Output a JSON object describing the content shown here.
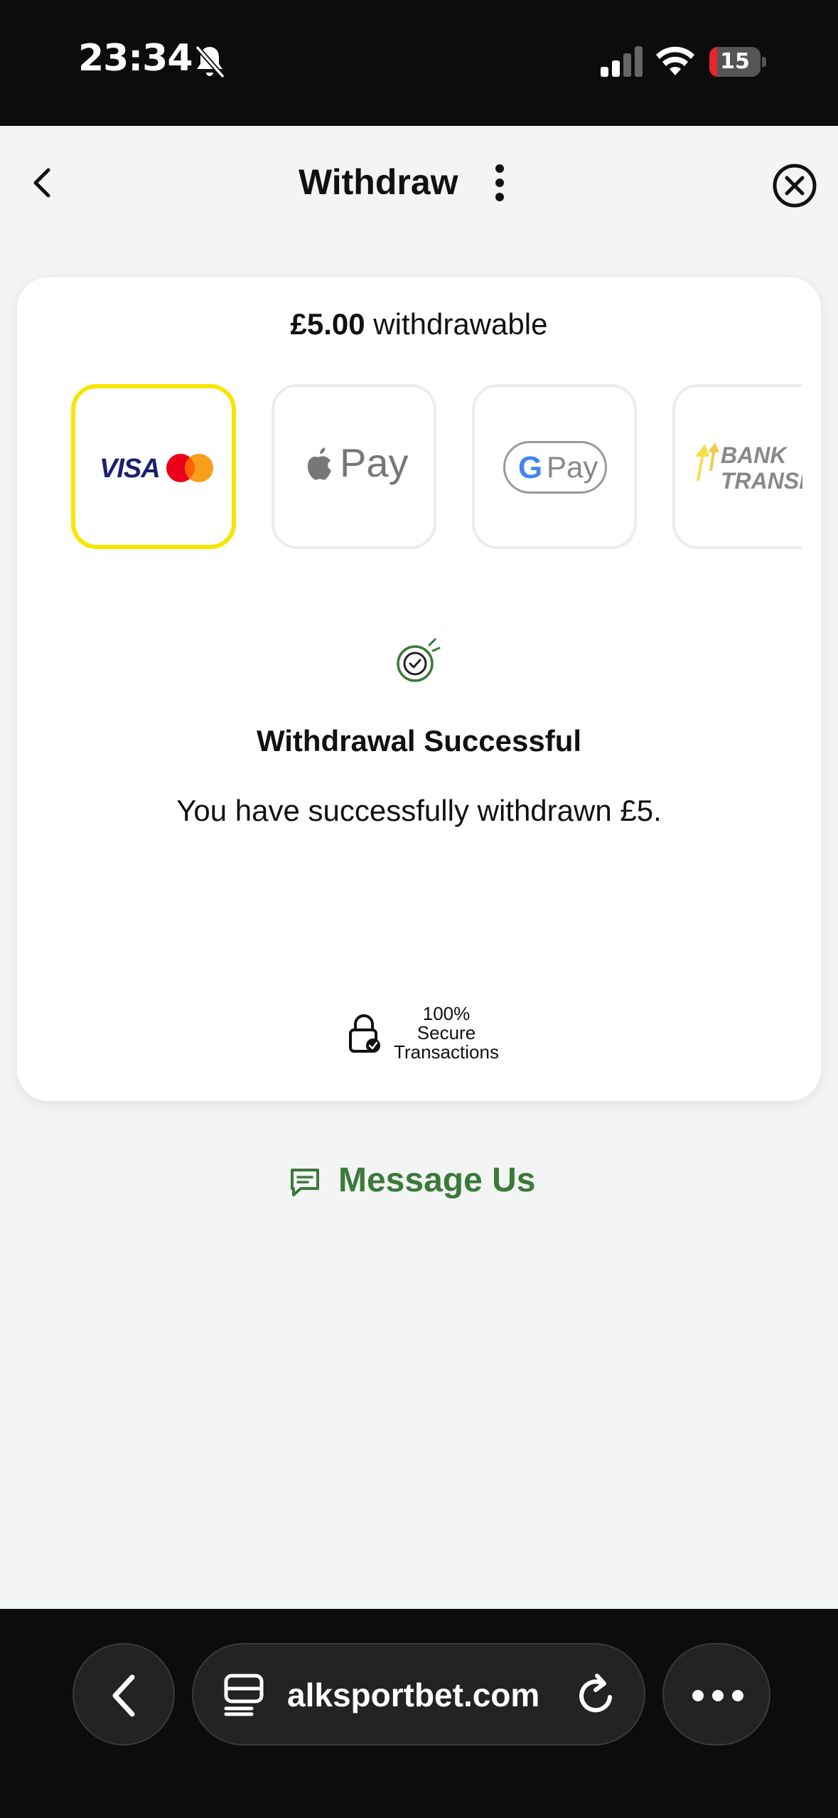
{
  "status_bar": {
    "time": "23:34",
    "battery_level": "15",
    "battery_fraction": 0.15,
    "icons": [
      "bell-muted-icon",
      "signal-icon",
      "wifi-icon",
      "battery-icon"
    ]
  },
  "header": {
    "title": "Withdraw",
    "icons": [
      "back-chevron-icon",
      "kebab-menu-icon",
      "close-circle-icon"
    ]
  },
  "card": {
    "withdrawable_amount": "£5.00",
    "withdrawable_label": " withdrawable",
    "payment_methods": [
      {
        "name": "Visa / Mastercard",
        "selected": true,
        "visa_text": "VISA"
      },
      {
        "name": "Apple Pay",
        "selected": false,
        "text": "Pay"
      },
      {
        "name": "Google Pay",
        "selected": false,
        "g": "G",
        "text": "Pay"
      },
      {
        "name": "Bank Transfer",
        "selected": false,
        "line1": "BANK",
        "line2": "TRANSFE"
      }
    ],
    "success_title": "Withdrawal Successful",
    "success_message": "You have successfully withdrawn £5.",
    "secure_text_1": "100%",
    "secure_text_2": "Secure",
    "secure_text_3": "Transactions"
  },
  "message_us": {
    "label": "Message Us"
  },
  "browser": {
    "url": "alksportbet.com"
  },
  "colors": {
    "selected_border": "#f6e600",
    "accent_green": "#3b7a3a",
    "visa_blue": "#1a1f71",
    "battery_red": "#e5262c"
  }
}
